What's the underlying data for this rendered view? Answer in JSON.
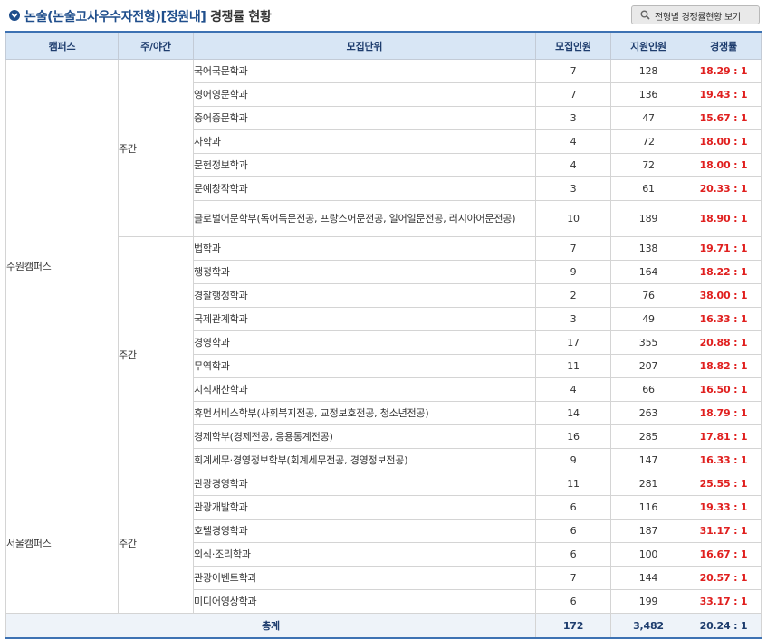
{
  "title": {
    "highlight": "논술(논술고사우수자전형)[정원내]",
    "rest": " 경쟁률 현황"
  },
  "view_button": {
    "label": "전형별 경쟁률현황 보기"
  },
  "columns": [
    "캠퍼스",
    "주/야간",
    "모집단위",
    "모집인원",
    "지원인원",
    "경쟁률"
  ],
  "campuses": [
    {
      "name": "수원캠퍼스",
      "groups": [
        {
          "daynight": "주간",
          "rows": [
            {
              "unit": "국어국문학과",
              "quota": "7",
              "applicants": "128",
              "ratio": "18.29 : 1"
            },
            {
              "unit": "영어영문학과",
              "quota": "7",
              "applicants": "136",
              "ratio": "19.43 : 1"
            },
            {
              "unit": "중어중문학과",
              "quota": "3",
              "applicants": "47",
              "ratio": "15.67 : 1"
            },
            {
              "unit": "사학과",
              "quota": "4",
              "applicants": "72",
              "ratio": "18.00 : 1"
            },
            {
              "unit": "문헌정보학과",
              "quota": "4",
              "applicants": "72",
              "ratio": "18.00 : 1"
            },
            {
              "unit": "문예창작학과",
              "quota": "3",
              "applicants": "61",
              "ratio": "20.33 : 1"
            },
            {
              "unit": "글로벌어문학부(독어독문전공, 프랑스어문전공, 일어일문전공, 러시아어문전공)",
              "quota": "10",
              "applicants": "189",
              "ratio": "18.90 : 1",
              "tall": true
            }
          ]
        },
        {
          "daynight": "주간",
          "rows": [
            {
              "unit": "법학과",
              "quota": "7",
              "applicants": "138",
              "ratio": "19.71 : 1"
            },
            {
              "unit": "행정학과",
              "quota": "9",
              "applicants": "164",
              "ratio": "18.22 : 1"
            },
            {
              "unit": "경찰행정학과",
              "quota": "2",
              "applicants": "76",
              "ratio": "38.00 : 1"
            },
            {
              "unit": "국제관계학과",
              "quota": "3",
              "applicants": "49",
              "ratio": "16.33 : 1"
            },
            {
              "unit": "경영학과",
              "quota": "17",
              "applicants": "355",
              "ratio": "20.88 : 1"
            },
            {
              "unit": "무역학과",
              "quota": "11",
              "applicants": "207",
              "ratio": "18.82 : 1"
            },
            {
              "unit": "지식재산학과",
              "quota": "4",
              "applicants": "66",
              "ratio": "16.50 : 1"
            },
            {
              "unit": "휴먼서비스학부(사회복지전공, 교정보호전공, 청소년전공)",
              "quota": "14",
              "applicants": "263",
              "ratio": "18.79 : 1"
            },
            {
              "unit": "경제학부(경제전공, 응용통계전공)",
              "quota": "16",
              "applicants": "285",
              "ratio": "17.81 : 1"
            },
            {
              "unit": "회계세무·경영정보학부(회계세무전공, 경영정보전공)",
              "quota": "9",
              "applicants": "147",
              "ratio": "16.33 : 1"
            }
          ]
        }
      ]
    },
    {
      "name": "서울캠퍼스",
      "groups": [
        {
          "daynight": "주간",
          "rows": [
            {
              "unit": "관광경영학과",
              "quota": "11",
              "applicants": "281",
              "ratio": "25.55 : 1"
            },
            {
              "unit": "관광개발학과",
              "quota": "6",
              "applicants": "116",
              "ratio": "19.33 : 1"
            },
            {
              "unit": "호텔경영학과",
              "quota": "6",
              "applicants": "187",
              "ratio": "31.17 : 1"
            },
            {
              "unit": "외식·조리학과",
              "quota": "6",
              "applicants": "100",
              "ratio": "16.67 : 1"
            },
            {
              "unit": "관광이벤트학과",
              "quota": "7",
              "applicants": "144",
              "ratio": "20.57 : 1"
            },
            {
              "unit": "미디어영상학과",
              "quota": "6",
              "applicants": "199",
              "ratio": "33.17 : 1"
            }
          ]
        }
      ]
    }
  ],
  "total": {
    "label": "총계",
    "quota": "172",
    "applicants": "3,482",
    "ratio": "20.24 : 1"
  },
  "colors": {
    "accent": "#1f4e8c",
    "ratio": "#e0201f",
    "header_bg": "#d8e6f5"
  }
}
